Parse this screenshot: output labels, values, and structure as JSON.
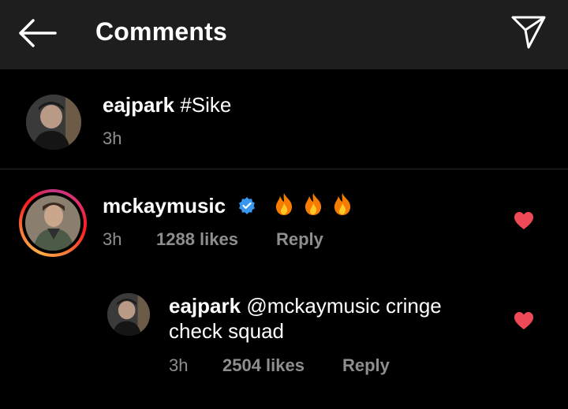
{
  "header": {
    "title": "Comments",
    "back_icon": "arrow-left-icon",
    "send_icon": "paper-plane-icon"
  },
  "caption": {
    "username": "eajpark",
    "text": "#Sike",
    "time": "3h"
  },
  "comments": [
    {
      "username": "mckaymusic",
      "verified": true,
      "text_emoji": [
        "fire-icon",
        "fire-icon",
        "fire-icon"
      ],
      "time": "3h",
      "likes": "1288 likes",
      "reply_label": "Reply",
      "liked": true
    }
  ],
  "replies": [
    {
      "username": "eajpark",
      "text_line1": "@mckaymusic cringe",
      "text_line2": "check squad",
      "time": "3h",
      "likes": "2504 likes",
      "reply_label": "Reply",
      "liked": true
    }
  ],
  "colors": {
    "header_bg": "#1e1e1e",
    "meta_text": "#8e8e8e",
    "heart": "#ed4956",
    "verified": "#3897f0"
  }
}
